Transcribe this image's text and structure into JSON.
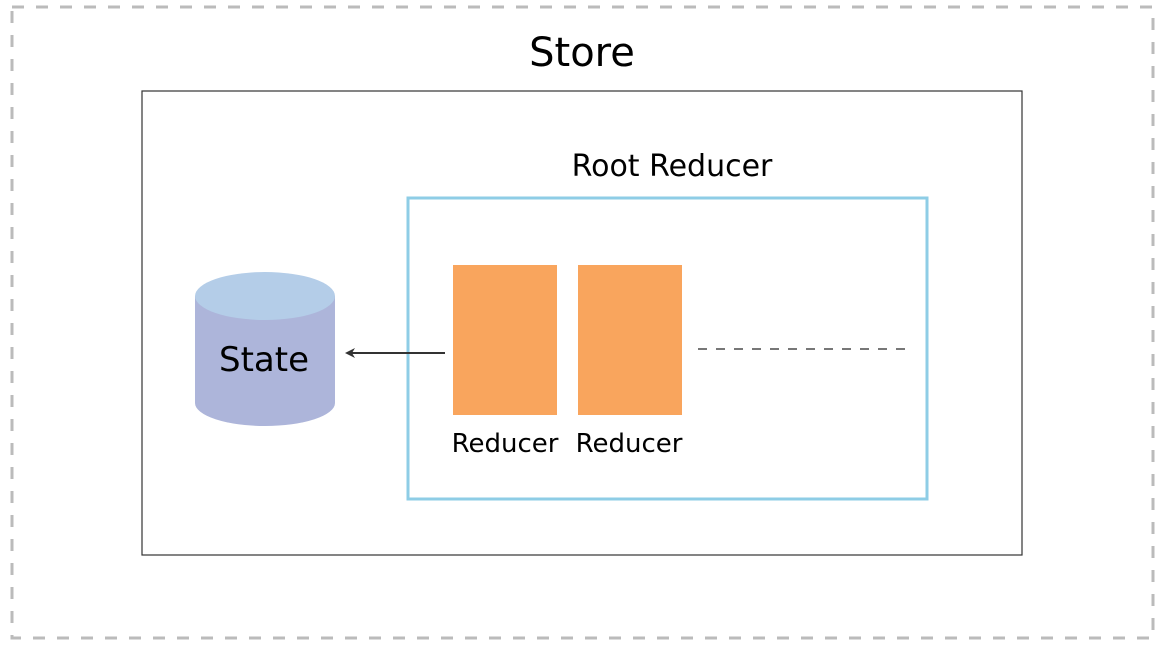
{
  "store": {
    "title": "Store"
  },
  "root_reducer": {
    "title": "Root Reducer"
  },
  "state": {
    "label": "State"
  },
  "reducers": [
    {
      "label": "Reducer"
    },
    {
      "label": "Reducer"
    }
  ],
  "colors": {
    "outer_dashed_border": "#bbbbbb",
    "store_border": "#333333",
    "root_reducer_border": "#8ecde6",
    "reducer_fill": "#f9a55d",
    "state_top": "#b4cde8",
    "state_body": "#adb5da",
    "arrow": "#333333",
    "ellipsis_line": "#777777"
  }
}
